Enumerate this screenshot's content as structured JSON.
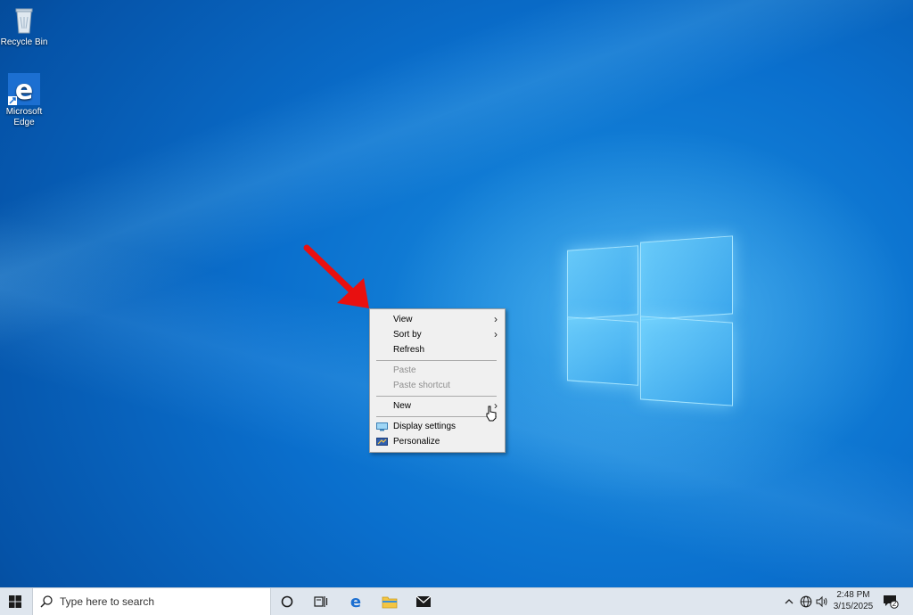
{
  "desktop": {
    "icons": [
      {
        "label": "Recycle Bin",
        "icon": "recycle-bin-icon"
      },
      {
        "label_line1": "Microsoft",
        "label_line2": "Edge",
        "icon": "edge-icon"
      }
    ]
  },
  "context_menu": {
    "items": [
      {
        "label": "View",
        "has_submenu": true,
        "enabled": true
      },
      {
        "label": "Sort by",
        "has_submenu": true,
        "enabled": true
      },
      {
        "label": "Refresh",
        "has_submenu": false,
        "enabled": true
      },
      {
        "label": "Paste",
        "has_submenu": false,
        "enabled": false
      },
      {
        "label": "Paste shortcut",
        "has_submenu": false,
        "enabled": false
      },
      {
        "label": "New",
        "has_submenu": true,
        "enabled": true
      },
      {
        "label": "Display settings",
        "has_submenu": false,
        "enabled": true,
        "icon": "display-icon"
      },
      {
        "label": "Personalize",
        "has_submenu": false,
        "enabled": true,
        "icon": "personalize-icon"
      }
    ]
  },
  "annotation": {
    "color": "#e81010",
    "icon": "red-arrow-icon"
  },
  "taskbar": {
    "search_placeholder": "Type here to search",
    "pinned": [
      "cortana-icon",
      "task-view-icon",
      "edge-icon",
      "file-explorer-icon",
      "mail-icon"
    ],
    "tray": {
      "time": "2:48 PM",
      "date": "3/15/2025",
      "notification_count": "2"
    }
  },
  "colors": {
    "desktop_blue": "#0a6fcd",
    "taskbar": "#dfe6ee",
    "menu_bg": "#f0f0f0",
    "disabled_text": "#8f8f8f"
  }
}
